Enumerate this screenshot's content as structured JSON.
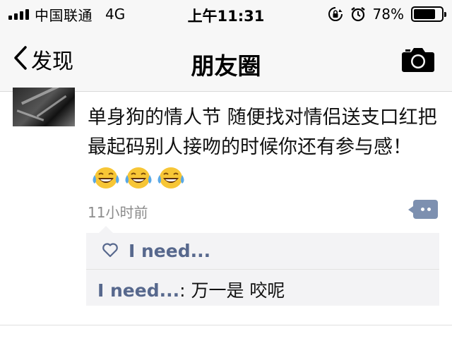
{
  "status_bar": {
    "carrier": "中国联通",
    "network": "4G",
    "time": "上午11:31",
    "battery_percent": "78%",
    "battery_level": 0.78
  },
  "nav": {
    "back_label": "发现",
    "title": "朋友圈",
    "camera_icon": "camera-icon"
  },
  "post": {
    "text": "单身狗的情人节 随便找对情侣送支口红把 最起码别人接吻的时候你还有参与感！",
    "emoji": [
      "face-with-tears-of-joy",
      "face-with-tears-of-joy",
      "face-with-tears-of-joy"
    ],
    "time_ago": "11小时前",
    "likes": [
      "I need..."
    ],
    "comments": [
      {
        "author": "I need...",
        "separator": ": ",
        "text": "万一是 咬呢"
      }
    ]
  },
  "colors": {
    "link_blue": "#57688d",
    "comment_button": "#7d90b0",
    "bar_background": "#f7f7f7"
  }
}
